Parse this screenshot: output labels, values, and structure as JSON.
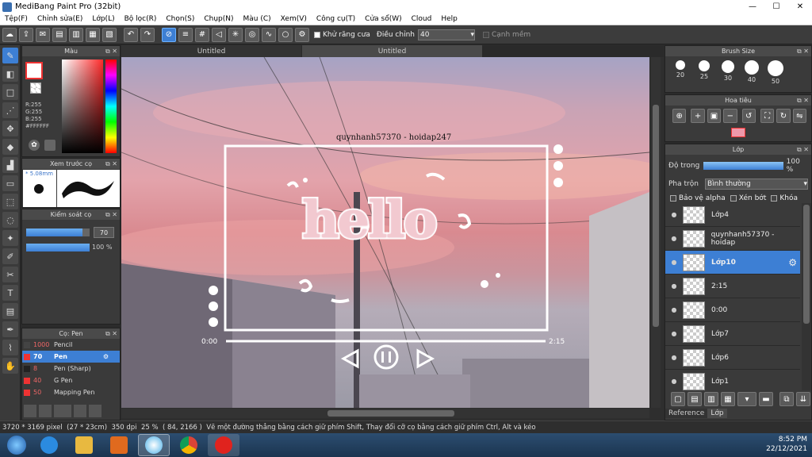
{
  "window": {
    "title": "MediBang Paint Pro (32bit)",
    "controls": [
      "—",
      "☐",
      "✕"
    ]
  },
  "menu": [
    "Tệp(F)",
    "Chỉnh sửa(E)",
    "Lớp(L)",
    "Bộ lọc(R)",
    "Chọn(S)",
    "Chụp(N)",
    "Màu (C)",
    "Xem(V)",
    "Công cụ(T)",
    "Cửa sổ(W)",
    "Cloud",
    "Help"
  ],
  "toolbar": {
    "antialias_label": "Khử răng cưa",
    "correction_label": "Điều chỉnh",
    "correction_value": "40",
    "snap_label": "Cạnh mềm"
  },
  "tabs": [
    "Untitled",
    "Untitled"
  ],
  "color_panel": {
    "title": "Màu",
    "r": "R:255",
    "g": "G:255",
    "b": "B:255",
    "hex": "#FFFFFF"
  },
  "brush_preview": {
    "title": "Xem trước cọ",
    "size": "5.08mm"
  },
  "brush_control": {
    "title": "Kiểm soát cọ",
    "size_value": "70",
    "opacity_value": "100 %",
    "size_fraction": 0.89,
    "opacity_fraction": 1.0
  },
  "brush_list": {
    "title": "Cọ: Pen",
    "items": [
      {
        "size": "1000",
        "name": "Pencil",
        "color": "#444"
      },
      {
        "size": "70",
        "name": "Pen",
        "color": "#e33"
      },
      {
        "size": "8",
        "name": "Pen (Sharp)",
        "color": "#222"
      },
      {
        "size": "40",
        "name": "G Pen",
        "color": "#e33"
      },
      {
        "size": "50",
        "name": "Mapping Pen",
        "color": "#e33"
      }
    ]
  },
  "brush_size_panel": {
    "title": "Brush Size",
    "sizes": [
      "20",
      "25",
      "30",
      "40",
      "50"
    ]
  },
  "navigator_panel": {
    "title": "Hoa tiêu"
  },
  "layer_panel": {
    "title": "Lớp",
    "opacity_label": "Độ trong",
    "opacity_value": "100 %",
    "blend_label": "Pha trộn",
    "blend_value": "Bình thường",
    "protect_alpha": "Bảo vệ alpha",
    "clipping": "Xén bớt",
    "lock": "Khóa",
    "layers": [
      "Lớp4",
      "quynhanh57370 - hoidap",
      "Lớp10",
      "2:15",
      "0:00",
      "Lớp7",
      "Lớp6",
      "Lớp1"
    ],
    "bottom_tabs": [
      "Reference",
      "Lớp"
    ]
  },
  "artwork": {
    "watermark": "quynhanh57370 - hoidap247",
    "headline": "hello",
    "time_start": "0:00",
    "time_end": "2:15"
  },
  "status": {
    "dimensions": "3720 * 3169 pixel",
    "size_cm": "(27 * 23cm)",
    "dpi": "350 dpi",
    "zoom": "25 %",
    "coords": "( 84, 2166 )",
    "hint": "Vẽ một đường thẳng bằng cách giữ phím Shift, Thay đổi cỡ cọ bằng cách giữ phím Ctrl, Alt và kéo"
  },
  "tray": {
    "time": "8:52 PM",
    "date": "22/12/2021"
  }
}
